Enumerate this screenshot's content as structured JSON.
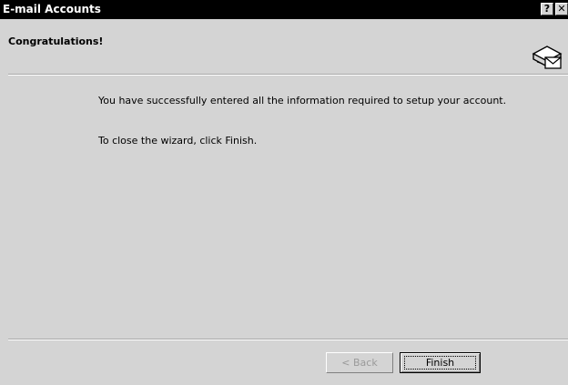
{
  "window": {
    "title": "E-mail Accounts",
    "help_button": "?",
    "close_button": "✕"
  },
  "header": {
    "title": "Congratulations!",
    "icon": "envelope-icon"
  },
  "content": {
    "line1": "You have successfully entered all the information required to setup your account.",
    "line2": "To close the wizard, click Finish."
  },
  "buttons": {
    "back_label": "< Back",
    "finish_label": "Finish"
  },
  "colors": {
    "titlebar": "#000000",
    "background": "#d4d4d4",
    "disabled_text": "#9a9a9a"
  }
}
